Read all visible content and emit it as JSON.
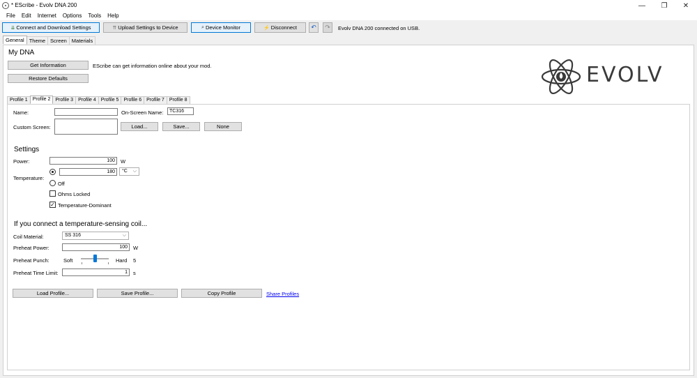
{
  "window": {
    "title": "* EScribe - Evolv DNA 200",
    "controls": {
      "minimize": "—",
      "maximize": "❐",
      "close": "✕"
    }
  },
  "menu": [
    "File",
    "Edit",
    "Internet",
    "Options",
    "Tools",
    "Help"
  ],
  "toolbar": {
    "connect_download": "Connect and Download Settings",
    "upload": "Upload Settings to Device",
    "device_monitor": "Device Monitor",
    "disconnect": "Disconnect",
    "status": "Evolv DNA 200 connected on USB."
  },
  "main_tabs": [
    "General",
    "Theme",
    "Screen",
    "Materials"
  ],
  "my_dna": {
    "title": "My DNA",
    "get_information": "Get Information",
    "restore_defaults": "Restore Defaults",
    "info_text": "EScribe can get information online about your mod."
  },
  "logo": {
    "text": "EVOLV"
  },
  "profile_tabs": [
    "Profile 1",
    "Profile 2",
    "Profile 3",
    "Profile 4",
    "Profile 5",
    "Profile 6",
    "Profile 7",
    "Profile 8"
  ],
  "profile": {
    "name_label": "Name:",
    "name_value": "",
    "onscreen_label": "On-Screen Name:",
    "onscreen_value": "TC316",
    "custom_screen_label": "Custom Screen:",
    "load": "Load...",
    "save": "Save...",
    "none": "None"
  },
  "settings": {
    "title": "Settings",
    "power_label": "Power:",
    "power_value": "100",
    "power_unit": "W",
    "temperature_label": "Temperature:",
    "temperature_value": "180",
    "temperature_unit": "°C",
    "off_label": "Off",
    "ohms_locked_label": "Ohms Locked",
    "ohms_locked": false,
    "temp_dominant_label": "Temperature-Dominant",
    "temp_dominant": true
  },
  "coil": {
    "title": "If you connect a temperature-sensing coil...",
    "material_label": "Coil Material:",
    "material_value": "SS 316",
    "preheat_power_label": "Preheat Power:",
    "preheat_power_value": "100",
    "preheat_power_unit": "W",
    "preheat_punch_label": "Preheat Punch:",
    "punch_soft": "Soft",
    "punch_hard": "Hard",
    "punch_value": "5",
    "punch_level_fraction": 0.5,
    "preheat_time_label": "Preheat Time Limit:",
    "preheat_time_value": "1",
    "preheat_time_unit": "s"
  },
  "bottom_buttons": {
    "load_profile": "Load Profile...",
    "save_profile": "Save Profile...",
    "copy_profile": "Copy Profile",
    "share_profiles": "Share Profiles"
  },
  "colors": {
    "accent": "#0078d7",
    "link": "#0000ee",
    "logo": "#3a3a3a"
  }
}
